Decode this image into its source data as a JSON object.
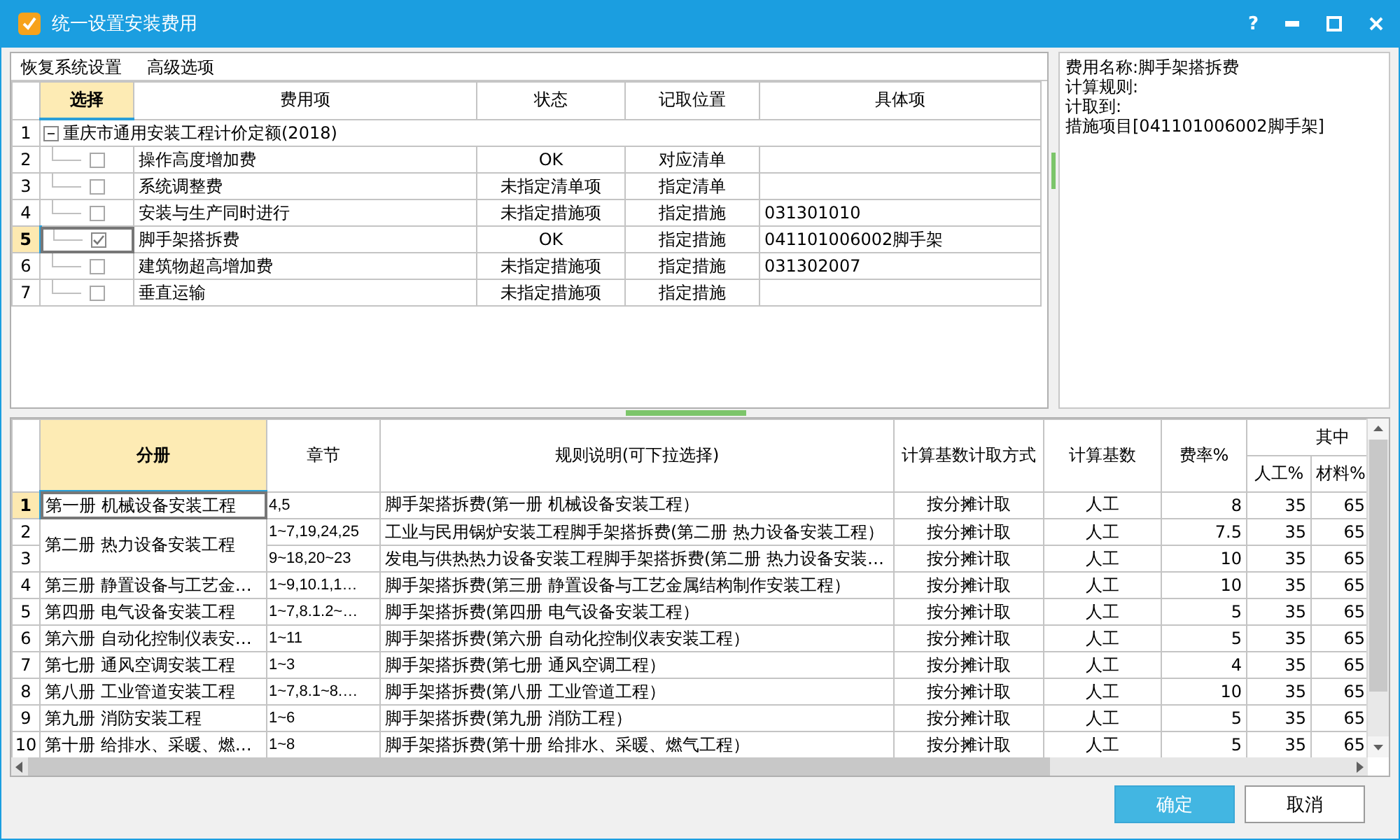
{
  "window": {
    "title": "统一设置安装费用",
    "help": "?"
  },
  "top_panel": {
    "menu": [
      "恢复系统设置",
      "高级选项"
    ],
    "columns": [
      {
        "label": "选择",
        "selected": true
      },
      {
        "label": "费用项",
        "selected": false
      },
      {
        "label": "状态",
        "selected": false
      },
      {
        "label": "记取位置",
        "selected": false
      },
      {
        "label": "具体项",
        "selected": false
      }
    ],
    "tree": {
      "number": "1",
      "label": "重庆市通用安装工程计价定额(2018)",
      "expanded": true,
      "children": [
        {
          "number": "2",
          "name": "操作高度增加费",
          "checked": false,
          "status": "OK",
          "location": "对应清单",
          "selected": false
        },
        {
          "number": "3",
          "name": "系统调整费",
          "checked": false,
          "status": "未指定清单项",
          "location": "指定清单",
          "selected": false
        },
        {
          "number": "4",
          "name": "安装与生产同时进行",
          "checked": false,
          "status": "未指定措施项",
          "location": "指定措施",
          "detail": "031301010",
          "selected": false
        },
        {
          "number": "5",
          "name": "脚手架搭拆费",
          "checked": true,
          "status": "OK",
          "location": "指定措施",
          "detail": "041101006002脚手架",
          "selected": true
        },
        {
          "number": "6",
          "name": "建筑物超高增加费",
          "checked": false,
          "status": "未指定措施项",
          "location": "指定措施",
          "detail": "031302007",
          "selected": false
        },
        {
          "number": "7",
          "name": "垂直运输",
          "checked": false,
          "status": "未指定措施项",
          "location": "指定措施",
          "selected": false
        }
      ]
    }
  },
  "info_panel": {
    "lines": [
      "费用名称:脚手架搭拆费",
      "计算规则:",
      "计取到:",
      "措施项目[041101006002脚手架]"
    ]
  },
  "bottom_table": {
    "columns": [
      {
        "label": "分册",
        "selected": true
      },
      {
        "label": "章节",
        "selected": false
      },
      {
        "label": "规则说明(可下拉选择)",
        "selected": false
      },
      {
        "label": "计算基数计取方式",
        "selected": false
      },
      {
        "label": "计算基数",
        "selected": false
      },
      {
        "label": "费率%",
        "selected": false
      },
      {
        "label": "其中",
        "selected": false,
        "children": [
          "人工%",
          "材料%"
        ]
      }
    ],
    "groups": [
      {
        "volume": "第一册 机械设备安装工程",
        "rows": [
          {
            "number": "1",
            "chapter": "4,5",
            "rule": "脚手架搭拆费(第一册 机械设备安装工程）",
            "method": "按分摊计取",
            "base": "人工",
            "rate": "8",
            "labor": "35",
            "material": "65",
            "selected": true
          }
        ]
      },
      {
        "volume": "第二册 热力设备安装工程",
        "rows": [
          {
            "number": "2",
            "chapter": "1~7,19,24,25",
            "rule": "工业与民用锅炉安装工程脚手架搭拆费(第二册 热力设备安装工程）",
            "method": "按分摊计取",
            "base": "人工",
            "rate": "7.5",
            "labor": "35",
            "material": "65",
            "selected": false
          },
          {
            "number": "3",
            "chapter": "9~18,20~23",
            "rule": "发电与供热热力设备安装工程脚手架搭拆费(第二册 热力设备安装…",
            "method": "按分摊计取",
            "base": "人工",
            "rate": "10",
            "labor": "35",
            "material": "65",
            "selected": false
          }
        ]
      },
      {
        "volume": "第三册 静置设备与工艺金…",
        "rows": [
          {
            "number": "4",
            "chapter": "1~9,10.1,1…",
            "rule": "脚手架搭拆费(第三册 静置设备与工艺金属结构制作安装工程）",
            "method": "按分摊计取",
            "base": "人工",
            "rate": "10",
            "labor": "35",
            "material": "65",
            "selected": false
          }
        ]
      },
      {
        "volume": "第四册 电气设备安装工程",
        "rows": [
          {
            "number": "5",
            "chapter": "1~7,8.1.2~…",
            "rule": "脚手架搭拆费(第四册 电气设备安装工程）",
            "method": "按分摊计取",
            "base": "人工",
            "rate": "5",
            "labor": "35",
            "material": "65",
            "selected": false
          }
        ]
      },
      {
        "volume": "第六册 自动化控制仪表安…",
        "rows": [
          {
            "number": "6",
            "chapter": "1~11",
            "rule": "脚手架搭拆费(第六册 自动化控制仪表安装工程）",
            "method": "按分摊计取",
            "base": "人工",
            "rate": "5",
            "labor": "35",
            "material": "65",
            "selected": false
          }
        ]
      },
      {
        "volume": "第七册 通风空调安装工程",
        "rows": [
          {
            "number": "7",
            "chapter": "1~3",
            "rule": "脚手架搭拆费(第七册 通风空调工程）",
            "method": "按分摊计取",
            "base": "人工",
            "rate": "4",
            "labor": "35",
            "material": "65",
            "selected": false
          }
        ]
      },
      {
        "volume": "第八册 工业管道安装工程",
        "rows": [
          {
            "number": "8",
            "chapter": "1~7,8.1~8.…",
            "rule": "脚手架搭拆费(第八册 工业管道工程）",
            "method": "按分摊计取",
            "base": "人工",
            "rate": "10",
            "labor": "35",
            "material": "65",
            "selected": false
          }
        ]
      },
      {
        "volume": "第九册 消防安装工程",
        "rows": [
          {
            "number": "9",
            "chapter": "1~6",
            "rule": "脚手架搭拆费(第九册 消防工程）",
            "method": "按分摊计取",
            "base": "人工",
            "rate": "5",
            "labor": "35",
            "material": "65",
            "selected": false
          }
        ]
      },
      {
        "volume": "第十册 给排水、采暖、燃…",
        "rows": [
          {
            "number": "10",
            "chapter": "1~8",
            "rule": "脚手架搭拆费(第十册 给排水、采暖、燃气工程）",
            "method": "按分摊计取",
            "base": "人工",
            "rate": "5",
            "labor": "35",
            "material": "65",
            "selected": false
          }
        ]
      }
    ]
  },
  "buttons": [
    {
      "label": "确定",
      "kind": "primary"
    },
    {
      "label": "取消",
      "kind": "secondary"
    }
  ]
}
